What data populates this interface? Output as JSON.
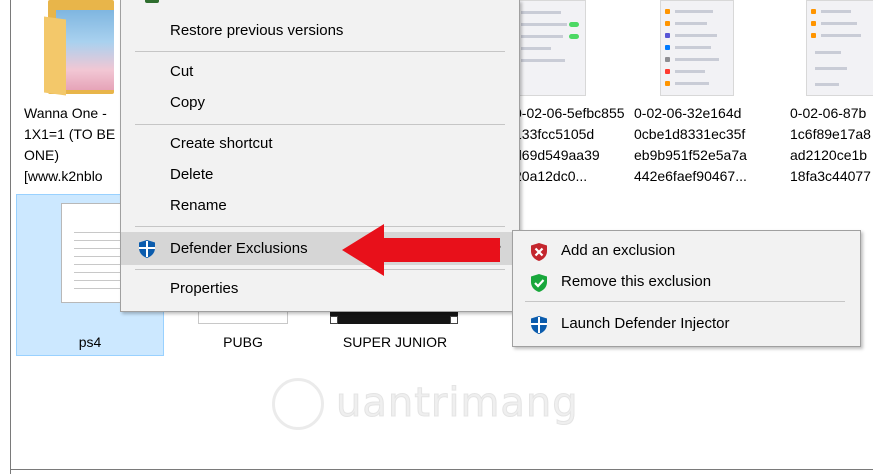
{
  "colors": {
    "menu_bg": "#f2f2f2",
    "menu_hover": "#d6d6d6",
    "selection": "#cce8ff",
    "selection_border": "#99d1ff",
    "arrow_red": "#e8101a",
    "defender_blue": "#0b5cad",
    "exclusion_red": "#c4262e",
    "exclusion_green": "#18a73b"
  },
  "files": {
    "folder_wannaone": {
      "label": "Wanna One -\n1X1=1 (TO BE\nONE)\n[www.k2nblo",
      "icon": "folder-icon"
    },
    "image1": {
      "label": "0-02-06-5efbc855\n133fcc5105d\nd69d549aa39\n20a12dc0..."
    },
    "image2": {
      "label": "0-02-06-32e164d\n0cbe1d8331ec35f\neb9b951f52e5a7a\n442e6faef90467..."
    },
    "image3": {
      "label": "0-02-06-87b\n1c6f89e17a8\nad2120ce1b\n18fa3c44077"
    },
    "ps4": {
      "label": "ps4",
      "icon": "document-icon"
    },
    "pubg": {
      "label": "PUBG"
    },
    "super_junior": {
      "label": "SUPER JUNIOR"
    }
  },
  "context_menu": {
    "restore_previous_versions": "Restore previous versions",
    "cut": "Cut",
    "copy": "Copy",
    "create_shortcut": "Create shortcut",
    "delete": "Delete",
    "rename": "Rename",
    "defender_exclusions": "Defender Exclusions",
    "properties": "Properties",
    "submenu_indicator": ">"
  },
  "submenu": {
    "add_exclusion": "Add an exclusion",
    "remove_exclusion": "Remove this exclusion",
    "launch_injector": "Launch Defender Injector"
  },
  "watermark": {
    "text": "uantrimang",
    "icon": "lightbulb-q-icon"
  }
}
